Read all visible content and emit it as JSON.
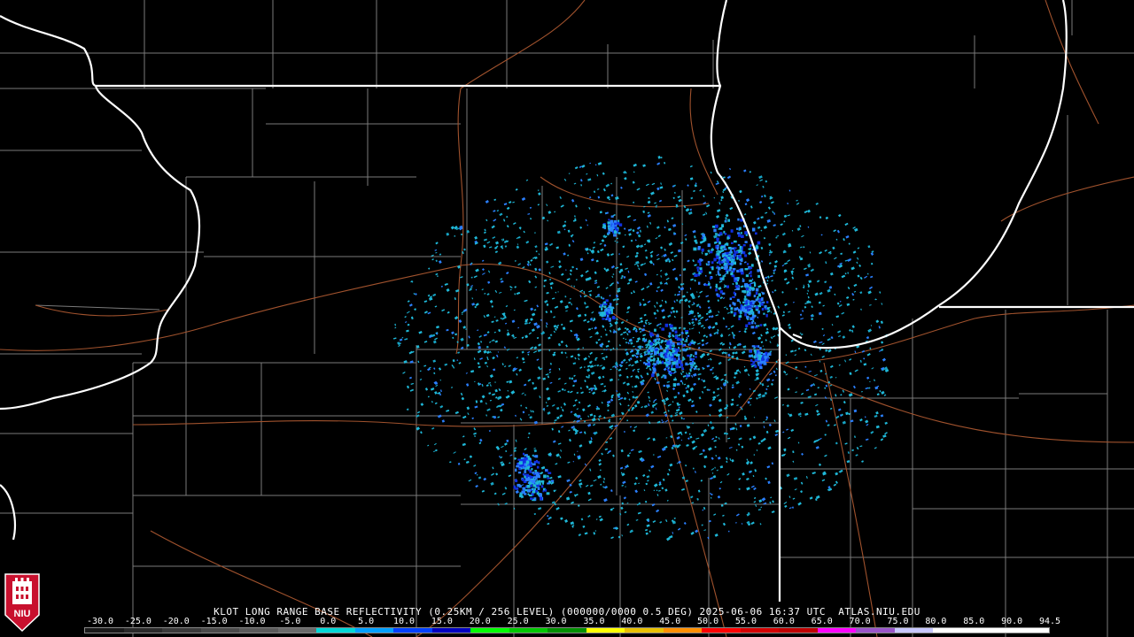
{
  "title": "KLOT LONG RANGE BASE REFLECTIVITY (0.25KM / 256 LEVEL) (000000/0000 0.5 DEG) 2025-06-06 16:37 UTC  ATLAS.NIU.EDU",
  "logo": {
    "text": "NIU",
    "icon": "niu-castle-logo"
  },
  "scale": {
    "labels": [
      "-30.0",
      "-25.0",
      "-20.0",
      "-15.0",
      "-10.0",
      "-5.0",
      "0.0",
      "5.0",
      "10.0",
      "15.0",
      "20.0",
      "25.0",
      "30.0",
      "35.0",
      "40.0",
      "45.0",
      "50.0",
      "55.0",
      "60.0",
      "65.0",
      "70.0",
      "75.0",
      "80.0",
      "85.0",
      "90.0",
      "94.5"
    ],
    "colors": [
      "#1a1a1a",
      "#2a2a2a",
      "#3a3a3a",
      "#4a4a4a",
      "#5a5a5a",
      "#6a6a6a",
      "#00d8d8",
      "#00a0ff",
      "#0040ff",
      "#0000c0",
      "#00ff00",
      "#00c800",
      "#009000",
      "#ffff00",
      "#e8c000",
      "#ff9000",
      "#ff0000",
      "#d40000",
      "#c00000",
      "#ff00ff",
      "#9955c9",
      "#c8c8ff",
      "#ffffff",
      "#ffffff",
      "#ffffff"
    ]
  },
  "colors": {
    "background": "#000000",
    "state_border": "#ffffff",
    "county_line": "#808080",
    "highway": "#a0522d",
    "echo_light": "#1fb8d8",
    "echo_mid": "#2a7fff",
    "echo_strong": "#1030e0"
  }
}
